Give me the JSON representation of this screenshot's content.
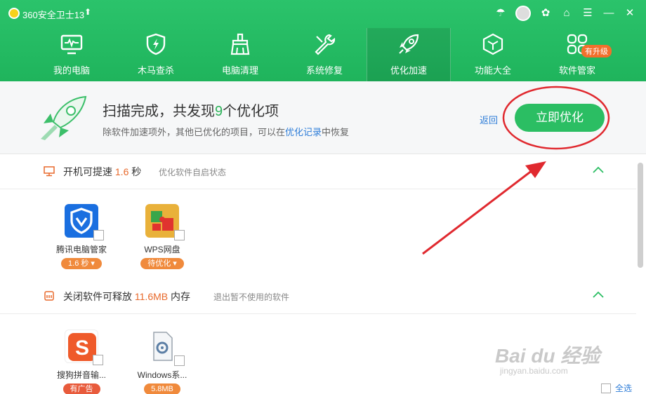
{
  "window": {
    "title": "360安全卫士13",
    "controls": [
      "umbrella-icon",
      "avatar",
      "skin-icon",
      "shirt-icon",
      "menu-icon",
      "minimize-icon",
      "close-icon"
    ]
  },
  "nav": {
    "items": [
      {
        "label": "我的电脑",
        "icon": "monitor-icon"
      },
      {
        "label": "木马查杀",
        "icon": "shield-bolt-icon"
      },
      {
        "label": "电脑清理",
        "icon": "broom-icon"
      },
      {
        "label": "系统修复",
        "icon": "wrench-icon"
      },
      {
        "label": "优化加速",
        "icon": "rocket-icon",
        "active": true
      },
      {
        "label": "功能大全",
        "icon": "cube-icon"
      },
      {
        "label": "软件管家",
        "icon": "grid-icon",
        "badge": "有升级"
      }
    ]
  },
  "banner": {
    "title_prefix": "扫描完成，共发现",
    "count": "9",
    "title_suffix": "个优化项",
    "sub_prefix": "除软件加速项外，其他已优化的项目，可以在",
    "sub_link": "优化记录",
    "sub_suffix": "中恢复",
    "back": "返回",
    "optimize_button": "立即优化"
  },
  "sections": [
    {
      "title_prefix": "开机可提速",
      "value": "1.6",
      "unit": "秒",
      "note": "优化软件自启状态",
      "apps": [
        {
          "name": "腾讯电脑管家",
          "tag": "1.6 秒 ▾"
        },
        {
          "name": "WPS网盘",
          "tag": "待优化 ▾"
        }
      ]
    },
    {
      "title_prefix": "关闭软件可释放",
      "value": "11.6MB",
      "unit": "内存",
      "note": "退出暂不使用的软件",
      "apps": [
        {
          "name": "搜狗拼音输...",
          "tag": "有广告"
        },
        {
          "name": "Windows系...",
          "tag": "5.8MB"
        }
      ]
    }
  ],
  "footer": {
    "select_all": "全选"
  },
  "watermark": {
    "line1": "Bai du 经验",
    "line2": "jingyan.baidu.com"
  },
  "colors": {
    "brand_green": "#2bc36b",
    "accent_orange": "#e8692b",
    "link_blue": "#2e7dd8",
    "annotation_red": "#e0292f"
  }
}
